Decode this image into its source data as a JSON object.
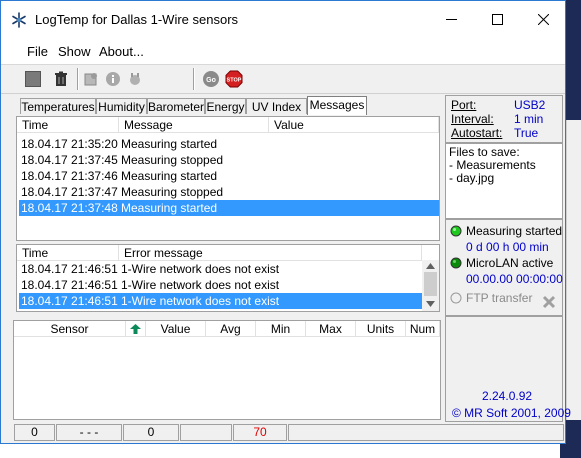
{
  "window": {
    "title": "LogTemp for Dallas 1-Wire sensors",
    "minimize_glyph": "—",
    "maximize_glyph": "☐",
    "close_glyph": "✕"
  },
  "menu": {
    "file": "File",
    "show": "Show",
    "about": "About..."
  },
  "toolbar": {
    "buttons": [
      {
        "name": "stop-square-icon"
      },
      {
        "name": "trash-icon"
      },
      {
        "name": "settings-icon"
      },
      {
        "name": "info-icon"
      },
      {
        "name": "sensor-icon"
      },
      {
        "name": "go-icon",
        "label": "Go"
      },
      {
        "name": "stop-sign-icon",
        "label": "STOP"
      }
    ]
  },
  "tabs": [
    "Temperatures",
    "Humidity",
    "Barometer",
    "Energy",
    "UV Index",
    "Messages"
  ],
  "messages_table": {
    "headers": [
      "Time",
      "Message",
      "Value"
    ],
    "rows": [
      {
        "time": "18.04.17 21:35:20",
        "message": "Measuring started"
      },
      {
        "time": "18.04.17 21:37:45",
        "message": "Measuring stopped"
      },
      {
        "time": "18.04.17 21:37:46",
        "message": "Measuring started"
      },
      {
        "time": "18.04.17 21:37:47",
        "message": "Measuring stopped"
      },
      {
        "time": "18.04.17 21:37:48",
        "message": "Measuring started"
      }
    ]
  },
  "errors_table": {
    "headers": [
      "Time",
      "Error message"
    ],
    "rows": [
      {
        "time": "18.04.17 21:46:51",
        "message": "1-Wire network does not exist"
      },
      {
        "time": "18.04.17 21:46:51",
        "message": "1-Wire network does not exist"
      },
      {
        "time": "18.04.17 21:46:51",
        "message": "1-Wire network does not exist"
      }
    ]
  },
  "sensor_table": {
    "headers": [
      "Sensor",
      "Value",
      "Avg",
      "Min",
      "Max",
      "Units",
      "Num"
    ]
  },
  "settings": {
    "port_label": "Port:",
    "port": "USB2",
    "interval_label": "Interval:",
    "interval": "1 min",
    "autostart_label": "Autostart:",
    "autostart": "True"
  },
  "files": {
    "title": "Files to save:",
    "items": [
      "- Measurements",
      "- day.jpg"
    ]
  },
  "status_panel": {
    "measuring_label": "Measuring started",
    "measuring_time": "0 d 00 h 00 min",
    "microlan_label": "MicroLAN active",
    "microlan_time": "00.00.00 00:00:00",
    "ftp_label": "FTP transfer"
  },
  "version": "2.24.0.92",
  "copyright": "© MR Soft 2001, 2009",
  "statusbar": [
    "0",
    "- - -",
    "0",
    "",
    "70"
  ],
  "colors": {
    "selection": "#3399ff",
    "status_red": "#e00000",
    "info_blue": "#0000c8",
    "led_green": "#1ec81e"
  }
}
